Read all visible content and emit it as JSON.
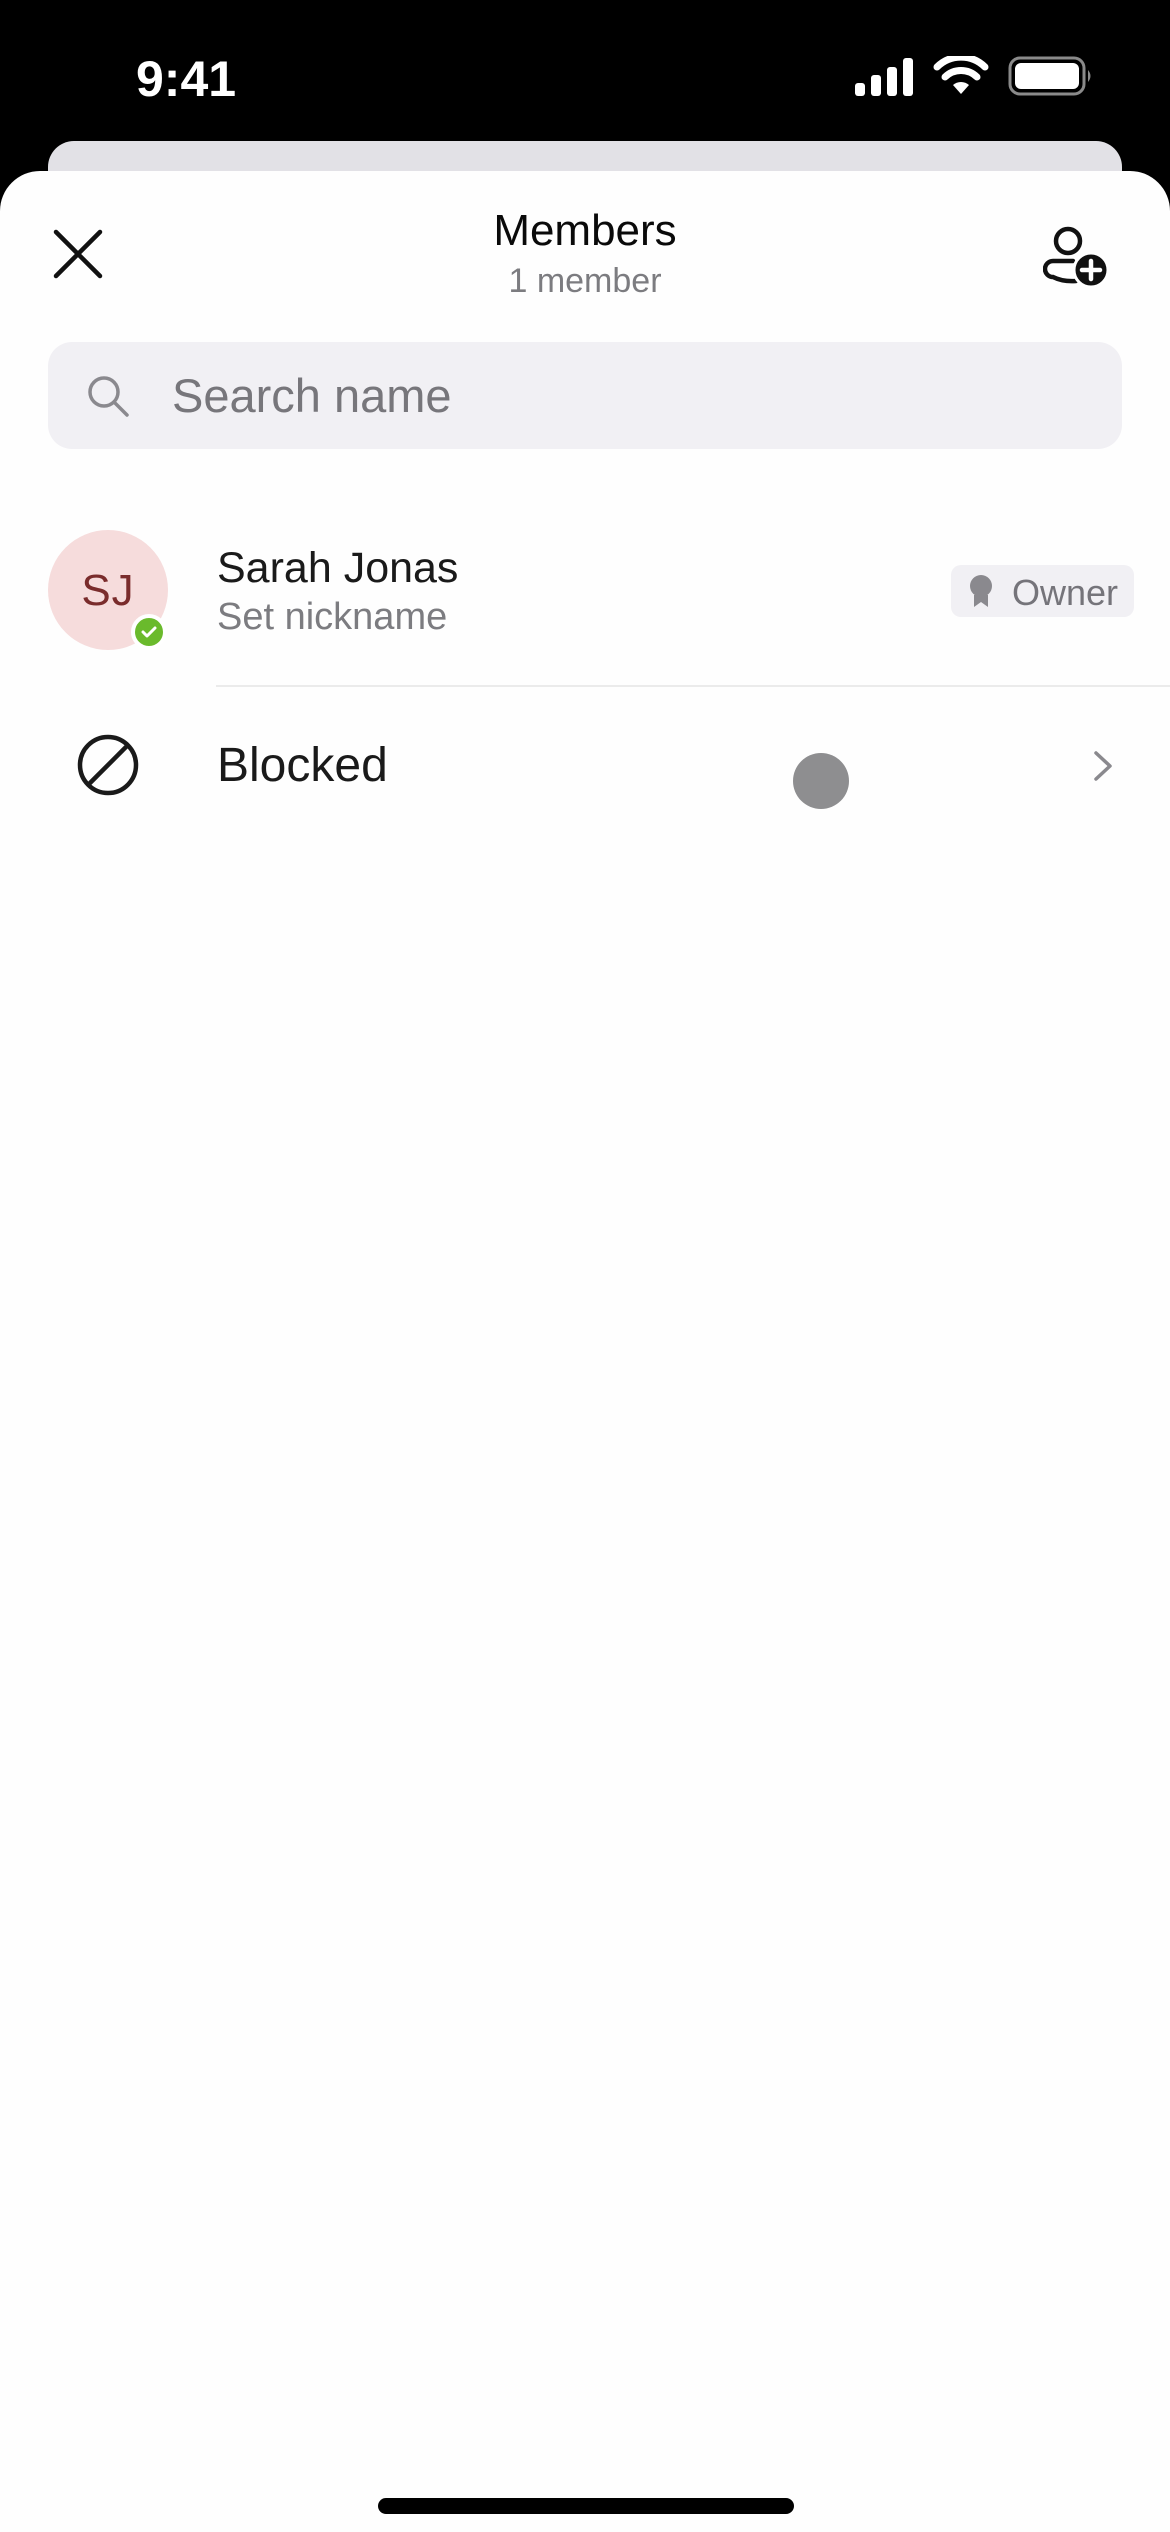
{
  "status_bar": {
    "time": "9:41",
    "icons": [
      "cellular-signal-icon",
      "wifi-icon",
      "battery-icon"
    ]
  },
  "header": {
    "title": "Members",
    "subtitle": "1 member",
    "close_icon": "close-icon",
    "add_member_icon": "add-person-icon"
  },
  "search": {
    "value": "",
    "placeholder": "Search name",
    "icon": "search-icon"
  },
  "members": [
    {
      "initials": "SJ",
      "name": "Sarah Jonas",
      "secondary": "Set nickname",
      "role": "Owner",
      "role_icon": "ribbon-icon",
      "presence": "available",
      "avatar_bg": "#f6dcdc",
      "avatar_fg": "#7a2c2c",
      "presence_color": "#6aba2c"
    }
  ],
  "blocked": {
    "label": "Blocked",
    "icon": "blocked-icon",
    "chevron_icon": "chevron-right-icon"
  }
}
